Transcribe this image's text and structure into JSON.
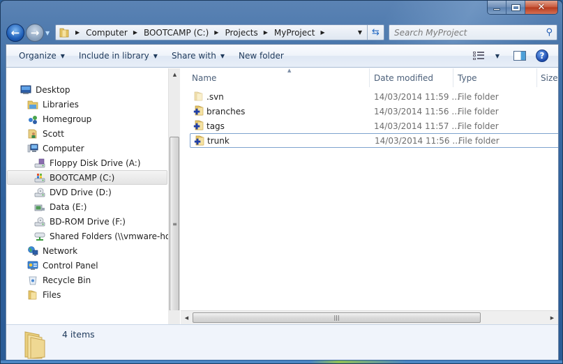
{
  "window": {
    "caption_buttons": {
      "minimize": "minimize",
      "maximize": "maximize",
      "close": "×"
    }
  },
  "navigation": {
    "back_icon": "arrow-left-icon",
    "forward_icon": "arrow-right-icon"
  },
  "address_bar": {
    "breadcrumbs": [
      {
        "label": "Computer"
      },
      {
        "label": "BOOTCAMP (C:)"
      },
      {
        "label": "Projects"
      },
      {
        "label": "MyProject"
      }
    ]
  },
  "search": {
    "placeholder": "Search MyProject",
    "value": ""
  },
  "toolbar": {
    "organize": "Organize",
    "include_in_library": "Include in library",
    "share_with": "Share with",
    "new_folder": "New folder",
    "help": "?"
  },
  "nav_pane": {
    "items": [
      {
        "label": "Desktop",
        "icon": "desktop-icon",
        "level": 0
      },
      {
        "label": "Libraries",
        "icon": "libraries-icon",
        "level": 1
      },
      {
        "label": "Homegroup",
        "icon": "homegroup-icon",
        "level": 1
      },
      {
        "label": "Scott",
        "icon": "user-folder-icon",
        "level": 1
      },
      {
        "label": "Computer",
        "icon": "computer-icon",
        "level": 1
      },
      {
        "label": "Floppy Disk Drive (A:)",
        "icon": "floppy-drive-icon",
        "level": 2
      },
      {
        "label": "BOOTCAMP (C:)",
        "icon": "windows-drive-icon",
        "level": 2,
        "selected": true
      },
      {
        "label": "DVD Drive (D:)",
        "icon": "dvd-drive-icon",
        "level": 2
      },
      {
        "label": "Data (E:)",
        "icon": "drive-icon",
        "level": 2
      },
      {
        "label": "BD-ROM Drive (F:)",
        "icon": "bd-rom-drive-icon",
        "level": 2
      },
      {
        "label": "Shared Folders (\\\\vmware-host)",
        "icon": "network-drive-icon",
        "level": 2
      },
      {
        "label": "Network",
        "icon": "network-icon",
        "level": 1
      },
      {
        "label": "Control Panel",
        "icon": "control-panel-icon",
        "level": 1
      },
      {
        "label": "Recycle Bin",
        "icon": "recycle-bin-icon",
        "level": 1
      },
      {
        "label": "Files",
        "icon": "folder-icon",
        "level": 1
      }
    ]
  },
  "file_list": {
    "columns": [
      "Name",
      "Date modified",
      "Type",
      "Size"
    ],
    "sort_column": "Name",
    "rows": [
      {
        "name": ".svn",
        "date": "14/03/2014 11:59 ...",
        "type": "File folder",
        "icon": "hidden-folder-icon"
      },
      {
        "name": "branches",
        "date": "14/03/2014 11:56 ...",
        "type": "File folder",
        "icon": "svn-folder-icon"
      },
      {
        "name": "tags",
        "date": "14/03/2014 11:57 ...",
        "type": "File folder",
        "icon": "svn-folder-icon"
      },
      {
        "name": "trunk",
        "date": "14/03/2014 11:56 ...",
        "type": "File folder",
        "icon": "svn-folder-icon",
        "focused": true
      }
    ]
  },
  "details_pane": {
    "item_count": "4 items"
  }
}
